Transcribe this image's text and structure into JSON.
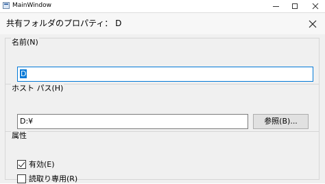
{
  "window": {
    "title": "MainWindow",
    "minimize_icon": "minimize-icon",
    "maximize_icon": "maximize-icon",
    "close_icon": "close-icon"
  },
  "dialog": {
    "title": "共有フォルダのプロパティ： D",
    "close_icon": "close-icon"
  },
  "name_group": {
    "label": "名前(N)",
    "value": "D"
  },
  "host_path_group": {
    "label": "ホスト パス(H)",
    "value": "D:¥",
    "browse_label": "参照(B)..."
  },
  "attributes_group": {
    "label": "属性",
    "enabled": {
      "label": "有効(E)",
      "checked": true
    },
    "readonly": {
      "label": "読取り専用(R)",
      "checked": false
    }
  },
  "colors": {
    "accent": "#0078d7",
    "dialog_bg": "#f0f0f0",
    "button_bg": "#e1e1e1"
  }
}
